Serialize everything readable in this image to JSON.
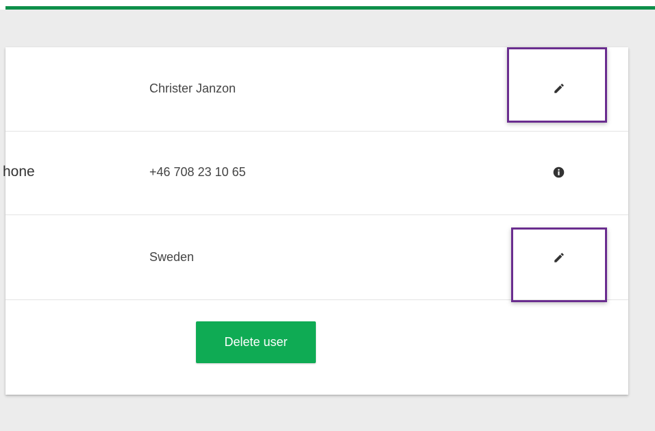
{
  "rows": [
    {
      "label": "",
      "value": "Christer Janzon",
      "action_icon": "pencil-icon"
    },
    {
      "label": "hone",
      "value": "+46 708 23 10 65",
      "action_icon": "info-icon"
    },
    {
      "label": "",
      "value": "Sweden",
      "action_icon": "pencil-icon"
    }
  ],
  "delete_button": {
    "label": "Delete user"
  },
  "colors": {
    "accent_green": "#0e8f4a",
    "button_green": "#0fab54",
    "highlight_purple": "#6a2d8f",
    "background": "#ececec"
  }
}
